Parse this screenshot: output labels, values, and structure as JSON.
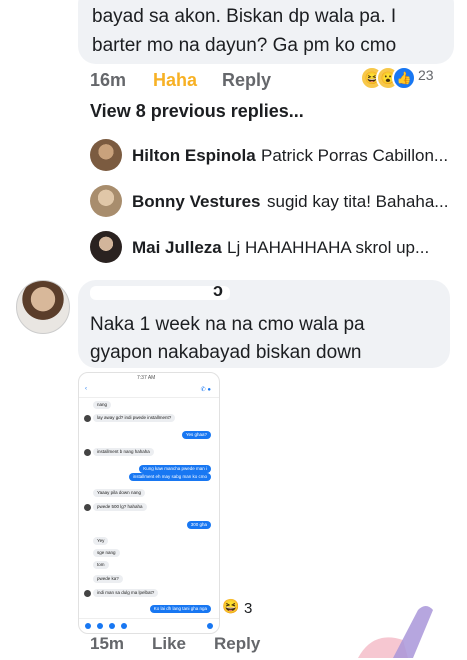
{
  "top_comment": {
    "lines": [
      "bayad sa akon. Biskan dp wala pa. I",
      "barter mo na dayun? Ga pm ko cmo"
    ],
    "time": "16m",
    "reaction_label": "Haha",
    "reply_label": "Reply",
    "reaction_count": "23"
  },
  "view_previous": "View 8 previous replies...",
  "replies": [
    {
      "name": "Hilton Espinola",
      "text": "Patrick Porras Cabillon..."
    },
    {
      "name": "Bonny Vestures",
      "text": "sugid kay tita! Bahaha..."
    },
    {
      "name": "Mai Julleza",
      "text": "Lj HAHAHHAHA skrol up..."
    }
  ],
  "second_comment": {
    "name_fragment": "ɔ",
    "lines": [
      "Naka 1 week na na cmo wala pa",
      "gyapon nakabayad biskan down"
    ],
    "screenshot": {
      "status": "7:37 AM",
      "messages": [
        {
          "dir": "in",
          "text": "nang"
        },
        {
          "dir": "in",
          "text": "lay away gd? indi pwede installment?"
        },
        {
          "dir": "out",
          "text": "Yes ghaa?"
        },
        {
          "dir": "in",
          "text": "installment b nang hahaha"
        },
        {
          "dir": "out",
          "text": "Kung kaw mancha pwede man i"
        },
        {
          "dir": "out",
          "text": "installment eh may sabg man ko cmo"
        },
        {
          "dir": "in",
          "text": "Yaaay pila down nang"
        },
        {
          "dir": "in",
          "text": "pwede 500 lg? hahaha"
        },
        {
          "dir": "out",
          "text": "300 gha"
        },
        {
          "dir": "in",
          "text": "Yey"
        },
        {
          "dir": "in",
          "text": "sge nang"
        },
        {
          "dir": "in",
          "text": "tom"
        },
        {
          "dir": "in",
          "text": "pwede ka?"
        },
        {
          "dir": "in",
          "text": "indi man sa dulg ma lpelbat?"
        },
        {
          "dir": "out",
          "text": "Ko lai dh lang tani gha nga"
        }
      ]
    },
    "reaction_count": "3",
    "time": "15m",
    "like_label": "Like",
    "reply_label": "Reply"
  },
  "colors": {
    "accent": "#1877f2",
    "haha": "#f7b125",
    "bubble": "#f0f2f5"
  }
}
